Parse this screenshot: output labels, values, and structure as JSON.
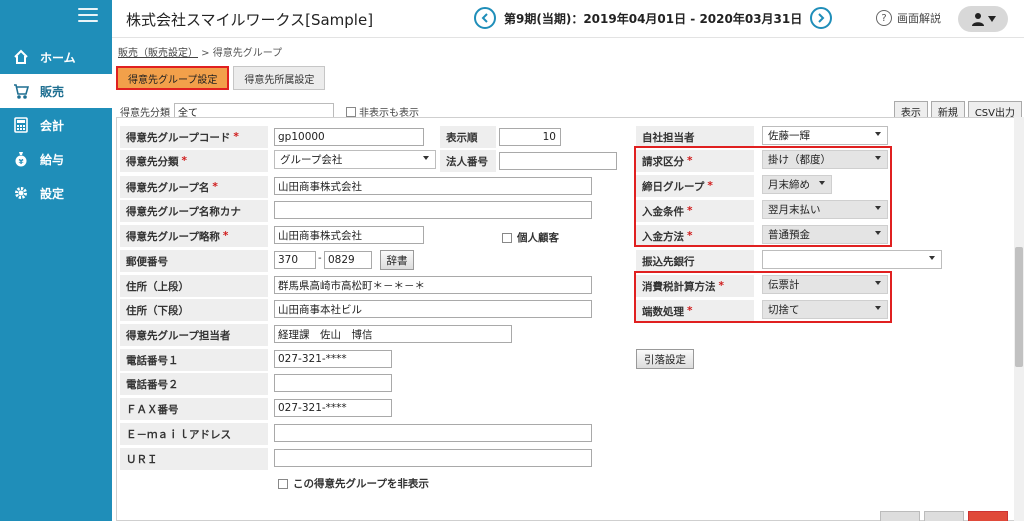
{
  "header": {
    "company": "株式会社スマイルワークス[Sample]",
    "period": "第9期(当期)：2019年04月01日 - 2020年03月31日",
    "help_label": "画面解説"
  },
  "sidebar": {
    "items": [
      {
        "label": "ホーム",
        "icon": "home-icon"
      },
      {
        "label": "販売",
        "icon": "cart-icon"
      },
      {
        "label": "会計",
        "icon": "calculator-icon"
      },
      {
        "label": "給与",
        "icon": "money-bag-icon"
      },
      {
        "label": "設定",
        "icon": "gear-icon"
      }
    ]
  },
  "breadcrumb": {
    "link": "販売（販売設定）",
    "sep": " > ",
    "current": "得意先グループ"
  },
  "tabs": [
    {
      "label": "得意先グループ設定"
    },
    {
      "label": "得意先所属設定"
    }
  ],
  "filter": {
    "label": "得意先分類",
    "select": "全て",
    "check": "非表示も表示",
    "buttons": [
      "表示",
      "新規",
      "CSV出力"
    ]
  },
  "form": {
    "group_code": {
      "label": "得意先グループコード",
      "value": "gp10000"
    },
    "display_order": {
      "label": "表示順",
      "value": "10"
    },
    "category": {
      "label": "得意先分類",
      "value": "グループ会社"
    },
    "corp_number": {
      "label": "法人番号",
      "value": ""
    },
    "group_name": {
      "label": "得意先グループ名",
      "value": "山田商事株式会社"
    },
    "group_kana": {
      "label": "得意先グループ名称カナ",
      "value": ""
    },
    "group_short": {
      "label": "得意先グループ略称",
      "value": "山田商事株式会社"
    },
    "individual": {
      "label": "個人顧客"
    },
    "postal": {
      "label": "郵便番号",
      "value1": "370",
      "value2": "0829",
      "button": "辞書"
    },
    "address1": {
      "label": "住所（上段）",
      "value": "群馬県高崎市高松町＊－＊－＊"
    },
    "address2": {
      "label": "住所（下段）",
      "value": "山田商事本社ビル"
    },
    "person": {
      "label": "得意先グループ担当者",
      "value": "経理課　佐山　博信"
    },
    "tel1": {
      "label": "電話番号１",
      "value": "027-321-****"
    },
    "tel2": {
      "label": "電話番号２",
      "value": ""
    },
    "fax": {
      "label": "ＦＡＸ番号",
      "value": "027-321-****"
    },
    "email": {
      "label": "Ｅ－ｍａｉｌアドレス",
      "value": ""
    },
    "url": {
      "label": "ＵＲＩ",
      "value": ""
    },
    "hide": {
      "label": "この得意先グループを非表示"
    },
    "own_person": {
      "label": "自社担当者",
      "value": "佐藤一輝"
    },
    "billing": {
      "label": "請求区分",
      "value": "掛け（都度）"
    },
    "closing": {
      "label": "締日グループ",
      "value": "月末締め"
    },
    "payment_cond": {
      "label": "入金条件",
      "value": "翌月末払い"
    },
    "payment_method": {
      "label": "入金方法",
      "value": "普通預金"
    },
    "bank": {
      "label": "振込先銀行",
      "value": ""
    },
    "tax_calc": {
      "label": "消費税計算方法",
      "value": "伝票計"
    },
    "rounding": {
      "label": "端数処理",
      "value": "切捨て"
    },
    "deduction_button": "引落設定"
  },
  "colors": {
    "sidebar": "#1f8eb9",
    "active_tab": "#f2a04a",
    "highlight": "#e02020",
    "required": "#d01c1c"
  }
}
